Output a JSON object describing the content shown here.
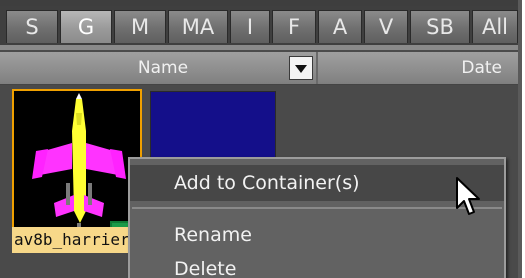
{
  "tabs": [
    {
      "label": "S",
      "active": false
    },
    {
      "label": "G",
      "active": true
    },
    {
      "label": "M",
      "active": false
    },
    {
      "label": "MA",
      "active": false
    },
    {
      "label": "I",
      "active": false
    },
    {
      "label": "F",
      "active": false
    },
    {
      "label": "A",
      "active": false
    },
    {
      "label": "V",
      "active": false
    },
    {
      "label": "SB",
      "active": false
    },
    {
      "label": "All",
      "active": false
    }
  ],
  "columns": {
    "name": "Name",
    "date": "Date"
  },
  "items": [
    {
      "label": "av8b_harrier",
      "icon": "jet-aircraft-icon"
    },
    {
      "label": "",
      "icon": "blue-thumbnail"
    }
  ],
  "context_menu": {
    "items": [
      {
        "label": "Add to Container(s)",
        "highlighted": true
      },
      {
        "label": "Rename",
        "highlighted": false
      },
      {
        "label": "Delete",
        "highlighted": false
      }
    ]
  },
  "colors": {
    "selection_border": "#f0a000",
    "label_background": "#f7d889",
    "thumbnail_blue": "#140f8a"
  }
}
